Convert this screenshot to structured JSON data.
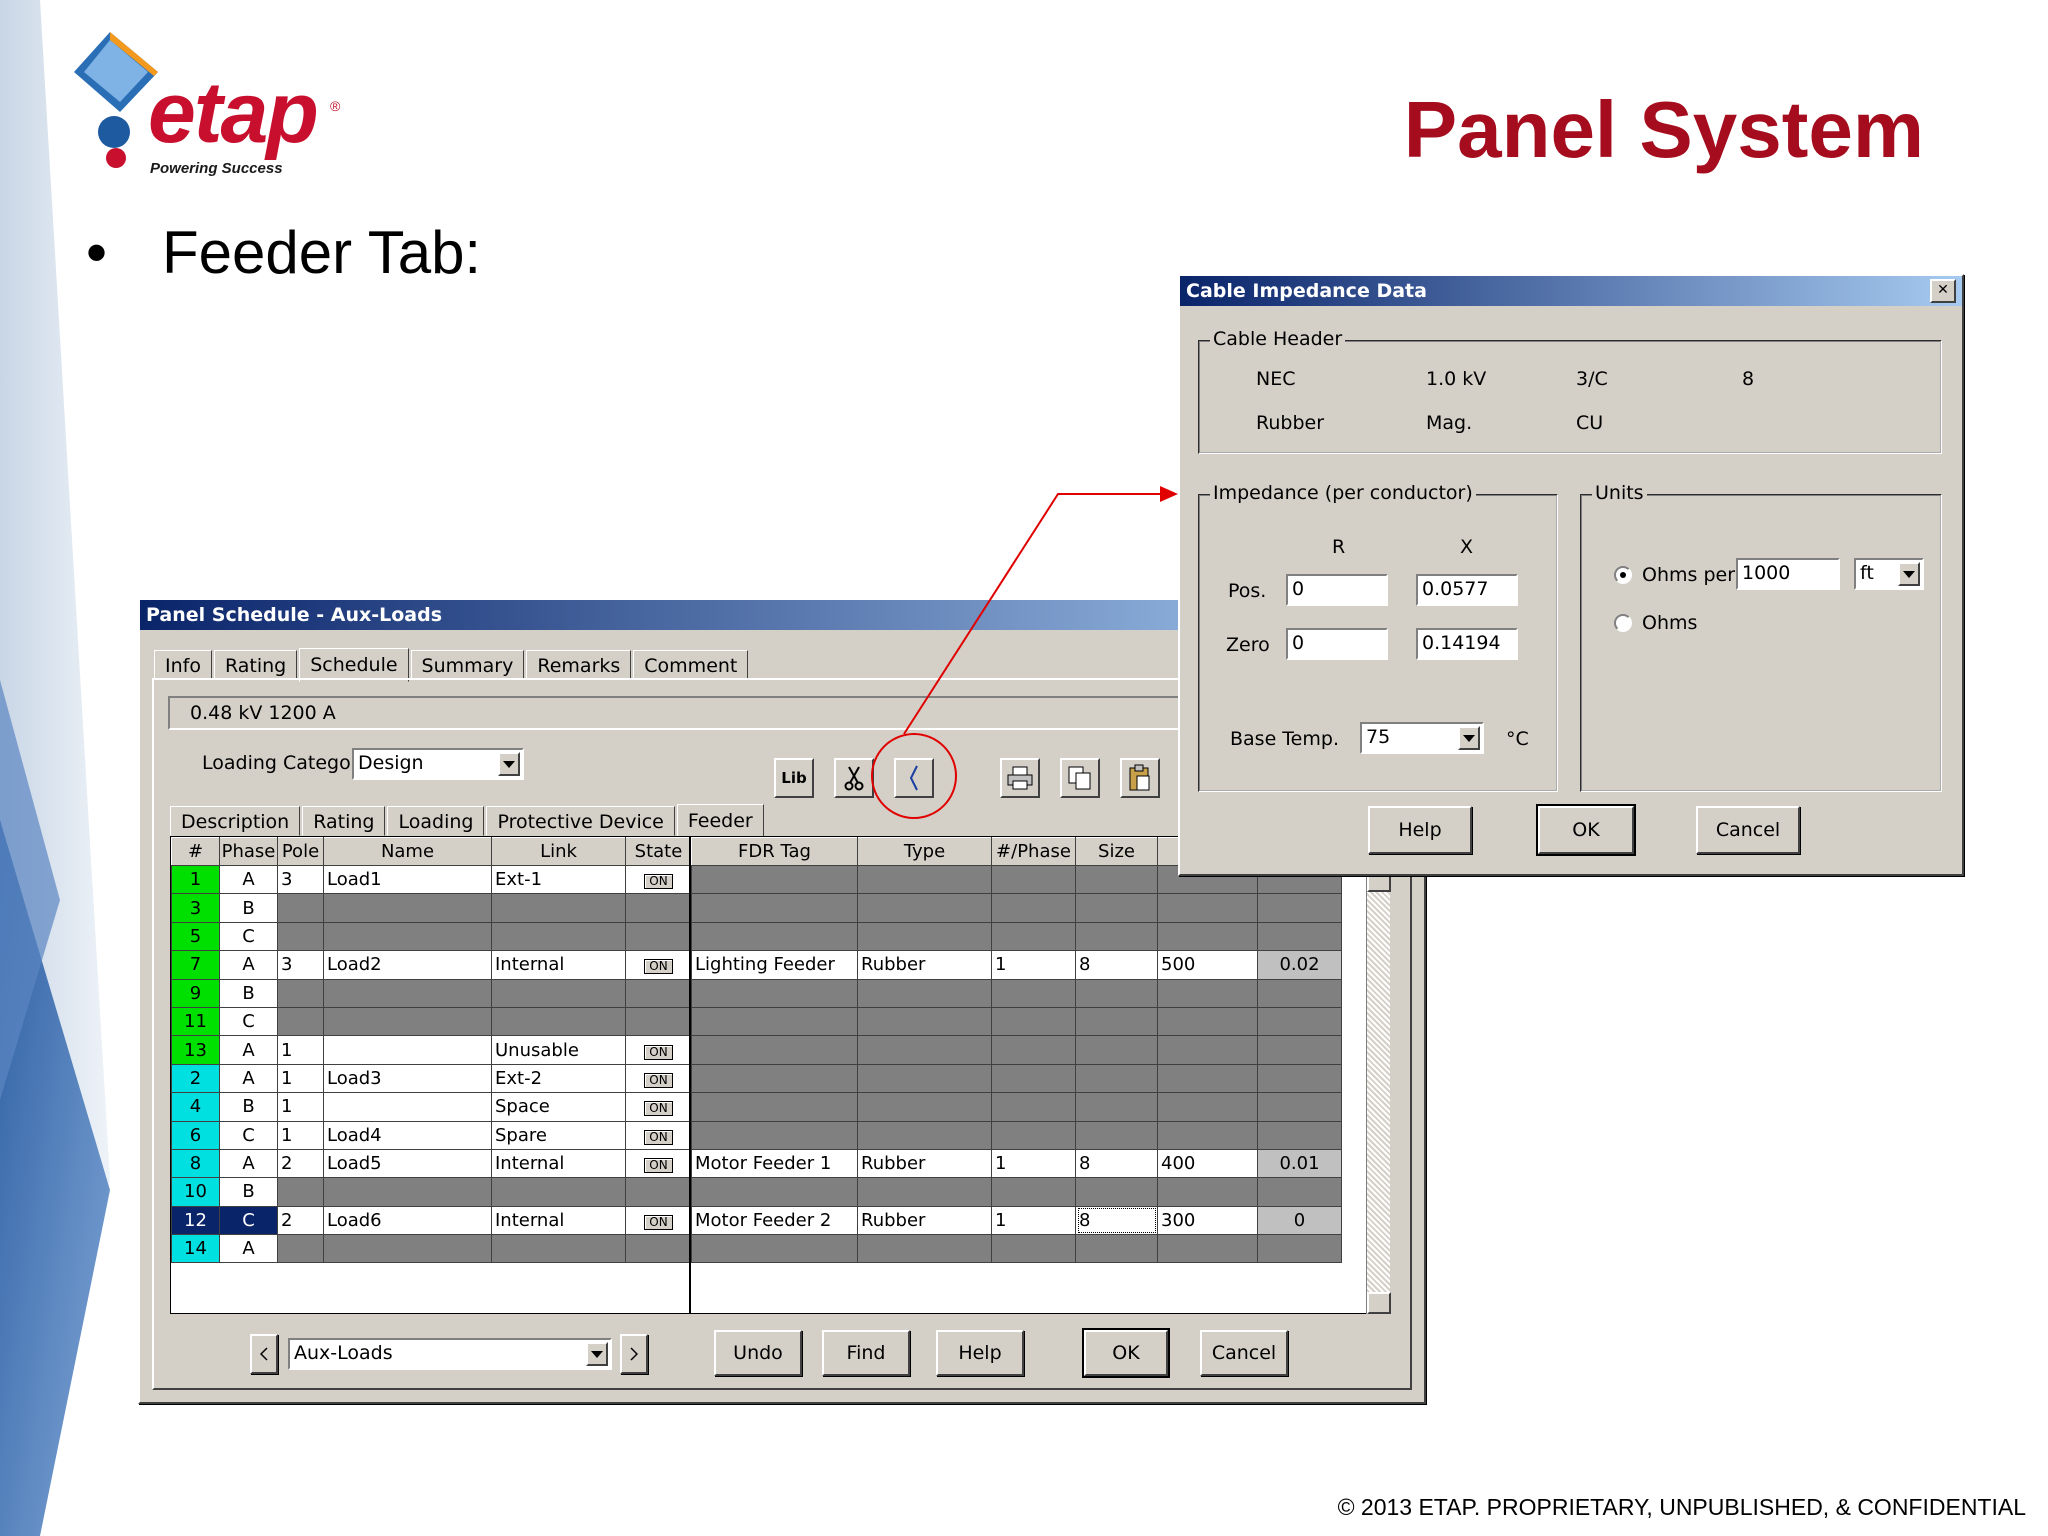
{
  "slide": {
    "brand": "etap",
    "brand_reg": "®",
    "brand_tagline": "Powering Success",
    "title": "Panel System",
    "bullet": "•",
    "bullet_text": "Feeder Tab:",
    "copyright": "© 2013 ETAP. PROPRIETARY, UNPUBLISHED, & CONFIDENTIAL",
    "title_color": "#a50d1e",
    "brand_color": "#c8102e"
  },
  "panel_schedule": {
    "title": "Panel Schedule - Aux-Loads",
    "tabs": [
      "Info",
      "Rating",
      "Schedule",
      "Summary",
      "Remarks",
      "Comment"
    ],
    "active_tab": "Schedule",
    "rating_text": "0.48 kV  1200 A",
    "loading_category_label": "Loading Category",
    "loading_category_value": "Design",
    "toolbar": {
      "lib": "Lib"
    },
    "subtabs": [
      "Description",
      "Rating",
      "Loading",
      "Protective Device",
      "Feeder"
    ],
    "active_subtab": "Feeder",
    "left_columns": [
      "#",
      "Phase",
      "Pole",
      "Name",
      "Link",
      "State"
    ],
    "right_columns": [
      "FDR Tag",
      "Type",
      "#/Phase",
      "Size",
      "",
      ""
    ],
    "rows": [
      {
        "num": "1",
        "phase": "A",
        "pole": "3",
        "name": "Load1",
        "link": "Ext-1",
        "state": "ON",
        "fdr": "",
        "type": "",
        "per": "",
        "size": "",
        "c5": "",
        "c6": "",
        "color": "#00e000",
        "gray": false,
        "rgray": true
      },
      {
        "num": "3",
        "phase": "B",
        "pole": "",
        "name": "",
        "link": "",
        "state": "",
        "fdr": "",
        "type": "",
        "per": "",
        "size": "",
        "c5": "",
        "c6": "",
        "color": "#00e000",
        "gray": true,
        "rgray": true
      },
      {
        "num": "5",
        "phase": "C",
        "pole": "",
        "name": "",
        "link": "",
        "state": "",
        "fdr": "",
        "type": "",
        "per": "",
        "size": "",
        "c5": "",
        "c6": "",
        "color": "#00e000",
        "gray": true,
        "rgray": true
      },
      {
        "num": "7",
        "phase": "A",
        "pole": "3",
        "name": "Load2",
        "link": "Internal",
        "state": "ON",
        "fdr": "Lighting Feeder",
        "type": "Rubber",
        "per": "1",
        "size": "8",
        "c5": "500",
        "c6": "0.02",
        "color": "#00e000",
        "gray": false,
        "rgray": false
      },
      {
        "num": "9",
        "phase": "B",
        "pole": "",
        "name": "",
        "link": "",
        "state": "",
        "fdr": "",
        "type": "",
        "per": "",
        "size": "",
        "c5": "",
        "c6": "",
        "color": "#00e000",
        "gray": true,
        "rgray": true
      },
      {
        "num": "11",
        "phase": "C",
        "pole": "",
        "name": "",
        "link": "",
        "state": "",
        "fdr": "",
        "type": "",
        "per": "",
        "size": "",
        "c5": "",
        "c6": "",
        "color": "#00e000",
        "gray": true,
        "rgray": true
      },
      {
        "num": "13",
        "phase": "A",
        "pole": "1",
        "name": "",
        "link": "Unusable",
        "state": "ON",
        "fdr": "",
        "type": "",
        "per": "",
        "size": "",
        "c5": "",
        "c6": "",
        "color": "#00e000",
        "gray": false,
        "rgray": true
      },
      {
        "num": "2",
        "phase": "A",
        "pole": "1",
        "name": "Load3",
        "link": "Ext-2",
        "state": "ON",
        "fdr": "",
        "type": "",
        "per": "",
        "size": "",
        "c5": "",
        "c6": "",
        "color": "#00e0e0",
        "gray": false,
        "rgray": true
      },
      {
        "num": "4",
        "phase": "B",
        "pole": "1",
        "name": "",
        "link": "Space",
        "state": "ON",
        "fdr": "",
        "type": "",
        "per": "",
        "size": "",
        "c5": "",
        "c6": "",
        "color": "#00e0e0",
        "gray": false,
        "rgray": true
      },
      {
        "num": "6",
        "phase": "C",
        "pole": "1",
        "name": "Load4",
        "link": "Spare",
        "state": "ON",
        "fdr": "",
        "type": "",
        "per": "",
        "size": "",
        "c5": "",
        "c6": "",
        "color": "#00e0e0",
        "gray": false,
        "rgray": true
      },
      {
        "num": "8",
        "phase": "A",
        "pole": "2",
        "name": "Load5",
        "link": "Internal",
        "state": "ON",
        "fdr": "Motor Feeder 1",
        "type": "Rubber",
        "per": "1",
        "size": "8",
        "c5": "400",
        "c6": "0.01",
        "color": "#00e0e0",
        "gray": false,
        "rgray": false
      },
      {
        "num": "10",
        "phase": "B",
        "pole": "",
        "name": "",
        "link": "",
        "state": "",
        "fdr": "",
        "type": "",
        "per": "",
        "size": "",
        "c5": "",
        "c6": "",
        "color": "#00e0e0",
        "gray": true,
        "rgray": true
      },
      {
        "num": "12",
        "phase": "C",
        "pole": "2",
        "name": "Load6",
        "link": "Internal",
        "state": "ON",
        "fdr": "Motor Feeder 2",
        "type": "Rubber",
        "per": "1",
        "size": "8",
        "c5": "300",
        "c6": "0",
        "color": "#0a246a",
        "gray": false,
        "rgray": false,
        "selected": true
      },
      {
        "num": "14",
        "phase": "A",
        "pole": "",
        "name": "",
        "link": "",
        "state": "",
        "fdr": "",
        "type": "",
        "per": "",
        "size": "",
        "c5": "",
        "c6": "",
        "color": "#00e0e0",
        "gray": true,
        "rgray": true
      }
    ],
    "nav_value": "Aux-Loads",
    "buttons": {
      "undo": "Undo",
      "find": "Find",
      "help": "Help",
      "ok": "OK",
      "cancel": "Cancel"
    }
  },
  "cable_impedance": {
    "title": "Cable Impedance Data",
    "close": "✕",
    "cable_header_label": "Cable Header",
    "header_row1": [
      "NEC",
      "1.0 kV",
      "3/C",
      "8"
    ],
    "header_row2": [
      "Rubber",
      "Mag.",
      "CU"
    ],
    "impedance_label": "Impedance (per conductor)",
    "col_r": "R",
    "col_x": "X",
    "pos_label": "Pos.",
    "zero_label": "Zero",
    "pos_r": "0",
    "pos_x": "0.0577",
    "zero_r": "0",
    "zero_x": "0.14194",
    "base_temp_label": "Base Temp.",
    "base_temp_value": "75",
    "base_temp_unit": "°C",
    "units_label": "Units",
    "ohms_per_label": "Ohms per",
    "ohms_per_value": "1000",
    "length_unit": "ft",
    "ohms_label": "Ohms",
    "selected_unit": "ohms_per",
    "buttons": {
      "help": "Help",
      "ok": "OK",
      "cancel": "Cancel"
    }
  }
}
